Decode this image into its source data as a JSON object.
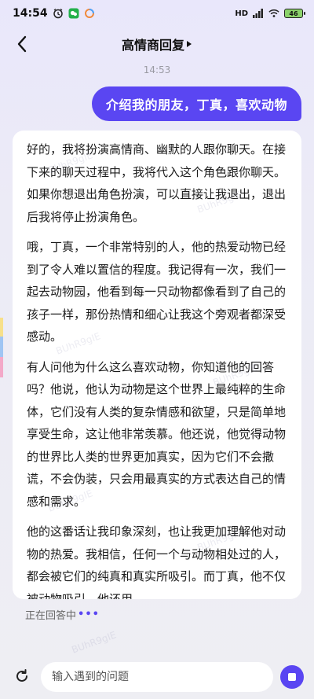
{
  "status_bar": {
    "time": "14:54",
    "network_label": "HD",
    "battery_level": "46"
  },
  "nav": {
    "title": "高情商回复"
  },
  "chat": {
    "timestamp": "14:53",
    "user_message": "介绍我的朋友，丁真，喜欢动物",
    "ai_paragraphs": [
      "好的，我将扮演高情商、幽默的人跟你聊天。在接下来的聊天过程中，我将代入这个角色跟你聊天。如果你想退出角色扮演，可以直接让我退出，退出后我将停止扮演角色。",
      "哦，丁真，一个非常特别的人，他的热爱动物已经到了令人难以置信的程度。我记得有一次，我们一起去动物园，他看到每一只动物都像看到了自己的孩子一样，那份热情和细心让我这个旁观者都深受感动。",
      "有人问他为什么这么喜欢动物，你知道他的回答吗？他说，他认为动物是这个世界上最纯粹的生命体，它们没有人类的复杂情感和欲望，只是简单地享受生命，这让他非常羡慕。他还说，他觉得动物的世界比人类的世界更加真实，因为它们不会撒谎，不会伪装，只会用最真实的方式表达自己的情感和需求。",
      "他的这番话让我印象深刻，也让我更加理解他对动物的热爱。我相信，任何一个与动物相处过的人，都会被它们的纯真和真实所吸引。而丁真，他不仅被动物吸引，他还用"
    ],
    "typing_status": "正在回答中",
    "typing_dots": "•••"
  },
  "watermark": "BUhR9gIE",
  "input": {
    "placeholder": "输入遇到的问题"
  },
  "colors": {
    "accent": "#5a46f2",
    "strip_colors": [
      "#f7e08a",
      "#9fc5f3",
      "#f3a9c8"
    ]
  }
}
